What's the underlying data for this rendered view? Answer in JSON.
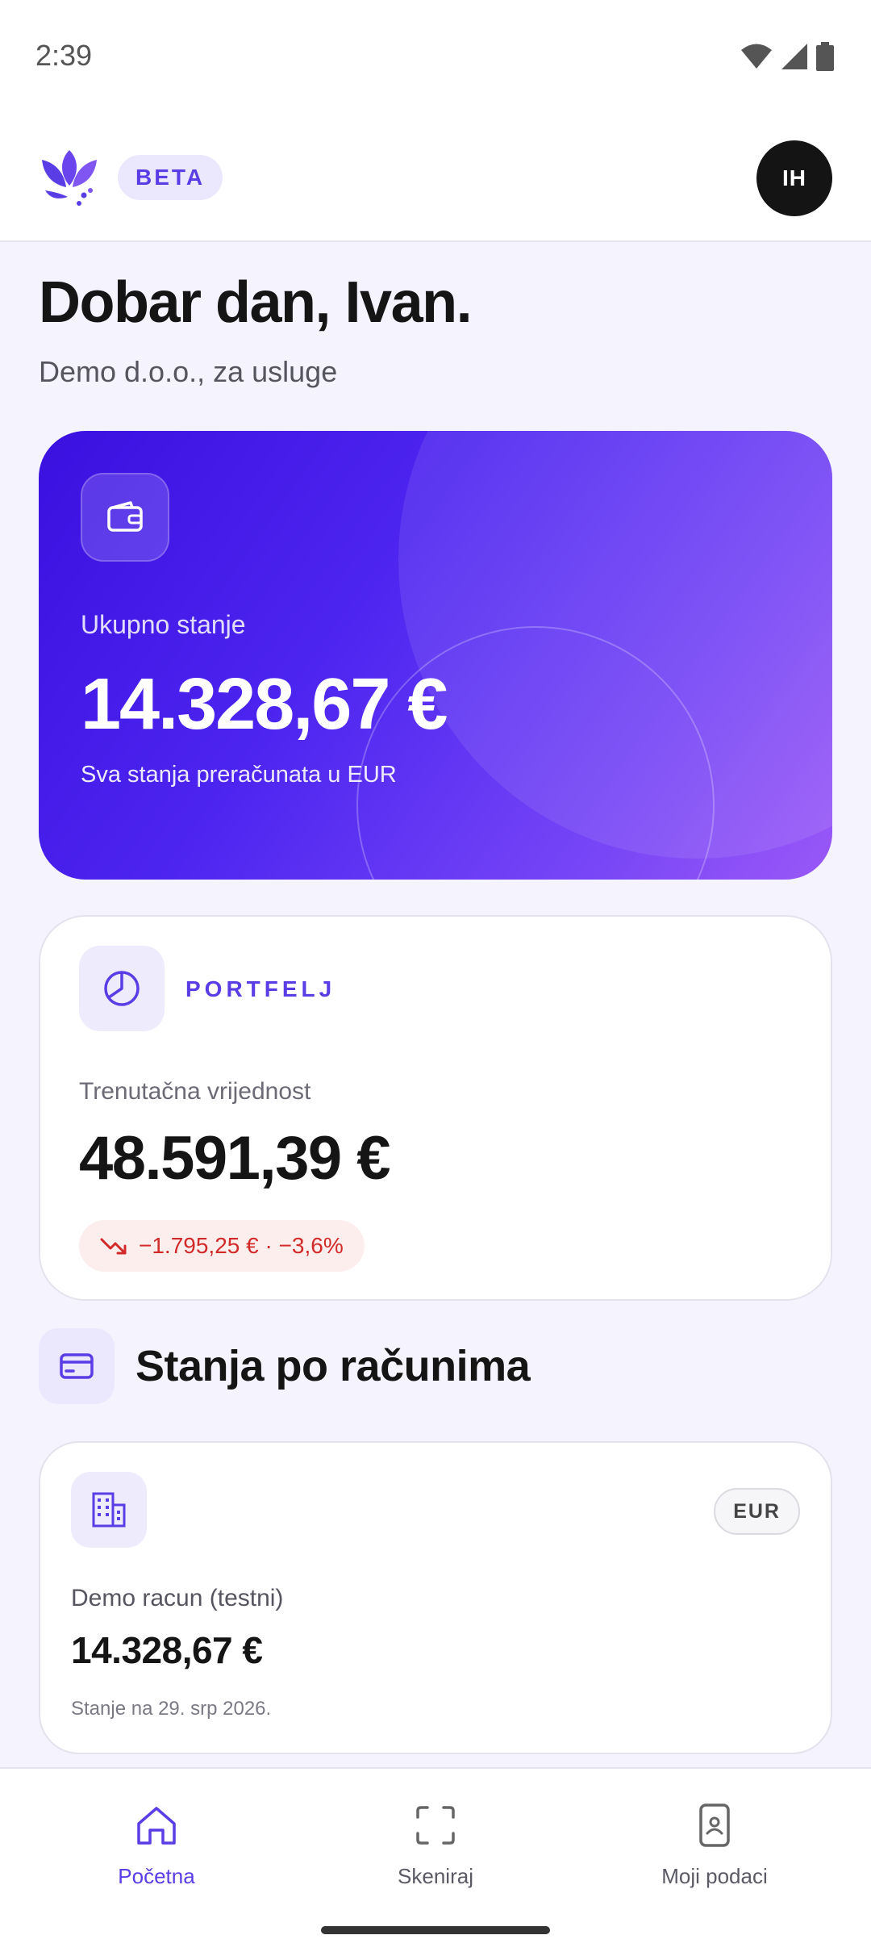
{
  "status_bar": {
    "time": "2:39",
    "icons": [
      "wifi-icon",
      "signal-icon",
      "battery-icon"
    ]
  },
  "header": {
    "beta_label": "BETA",
    "avatar_initials": "IH"
  },
  "greeting": {
    "title": "Dobar dan, Ivan.",
    "company": "Demo d.o.o., za usluge"
  },
  "balance_card": {
    "label": "Ukupno stanje",
    "value": "14.328,67 €",
    "note": "Sva stanja preračunata u EUR",
    "icon": "wallet-icon"
  },
  "portfolio": {
    "title": "PORTFELJ",
    "label": "Trenutačna vrijednost",
    "value": "48.591,39 €",
    "change": "−1.795,25 € · −3,6%",
    "change_icon": "trend-down-icon"
  },
  "accounts_section": {
    "title": "Stanja po računima",
    "icon": "card-icon"
  },
  "account": {
    "currency": "EUR",
    "name": "Demo racun (testni)",
    "balance": "14.328,67 €",
    "date": "Stanje na 29. srp 2026.",
    "icon": "building-icon"
  },
  "bottom_nav": {
    "items": [
      {
        "label": "Početna",
        "icon": "home-icon",
        "active": true
      },
      {
        "label": "Skeniraj",
        "icon": "scan-icon",
        "active": false
      },
      {
        "label": "Moji podaci",
        "icon": "phone-profile-icon",
        "active": false
      }
    ]
  },
  "colors": {
    "accent": "#5b3de6",
    "card_gradient_start": "#3a10e0",
    "card_gradient_end": "#9a58f7",
    "negative": "#d22a2a"
  }
}
